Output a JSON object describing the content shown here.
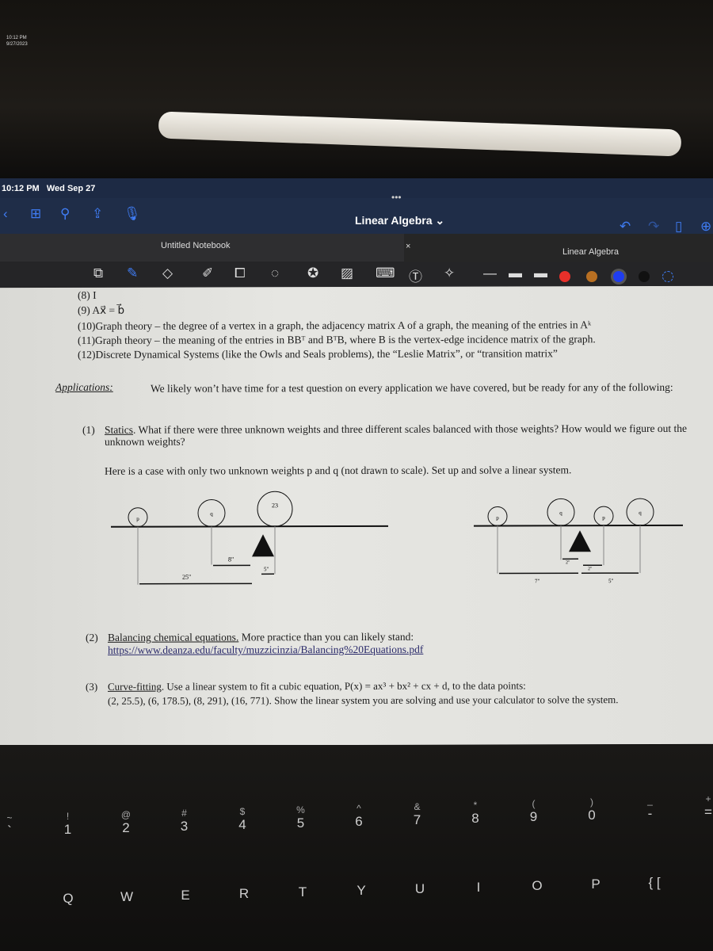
{
  "photo": {
    "mini_clock_time": "10:12 PM",
    "mini_clock_date": "9/27/2023"
  },
  "status": {
    "time": "10:12 PM",
    "date": "Wed Sep 27"
  },
  "topbar": {
    "title": "Linear Algebra",
    "more": "•••",
    "icons": [
      "back-icon",
      "grid-icon",
      "search-icon",
      "share-icon",
      "microphone-icon",
      "undo-icon",
      "redo-icon",
      "bookmark-icon",
      "add-page-icon"
    ]
  },
  "tabs": [
    {
      "label": "Untitled Notebook",
      "close": "×"
    },
    {
      "label": "Linear Algebra",
      "close": "×"
    }
  ],
  "tools": {
    "icons": [
      "zoom-window-icon",
      "pen-icon",
      "eraser-icon",
      "highlighter-icon",
      "shapes-icon",
      "lasso-icon",
      "sticker-icon",
      "image-icon",
      "keyboard-icon",
      "text-icon",
      "laser-pointer-icon"
    ],
    "colors": [
      "#e8302a",
      "#b86f22",
      "#1f3df0",
      "#111111"
    ],
    "selected_color": "#1f3df0"
  },
  "doc": {
    "list": [
      "(8) I",
      "(9) Ax⃗ = b⃗",
      "(10)Graph theory – the degree of a vertex in a graph, the adjacency matrix A of a graph, the meaning of the entries in Aᵏ",
      "(11)Graph theory – the meaning of the entries in BBᵀ and BᵀB, where B is the vertex-edge incidence matrix of the graph.",
      "(12)Discrete Dynamical Systems (like the Owls and Seals problems), the “Leslie Matrix”, or “transition matrix”"
    ],
    "applications_label": "Applications:",
    "applications_text": "We likely won’t have time for a test question on every application we have covered, but be ready for any of the following:",
    "item1_num": "(1)",
    "item1_title": "Statics",
    "item1_text": ". What if there were three unknown weights and three different scales balanced with those weights? How would we figure out the unknown weights?",
    "item1_sub": "Here is a case with only two unknown weights p and q (not drawn to scale). Set up and solve a linear system.",
    "fig1": {
      "w1": "p",
      "w2": "q",
      "w3": "23",
      "d1": "25\"",
      "d2": "8\"",
      "d3": "5\""
    },
    "fig2": {
      "w1": "p",
      "w2": "q",
      "w3": "p",
      "w4": "q",
      "d1": "7\"",
      "d2": "5\"",
      "d3": "2\"",
      "d4": "2\""
    },
    "item2_num": "(2)",
    "item2_title": "Balancing chemical equations.",
    "item2_text": " More practice than you can likely stand:",
    "item2_link": "https://www.deanza.edu/faculty/muzzicinzia/Balancing%20Equations.pdf",
    "item3_num": "(3)",
    "item3_title": "Curve-fitting",
    "item3_text": ". Use a linear system to fit a cubic equation, P(x) = ax³ + bx² + cx + d, to the data points:",
    "item3_points": "(2, 25.5), (6, 178.5), (8, 291), (16, 771).  Show the linear system you are solving and use your calculator to solve the system."
  },
  "keyboard": {
    "row1": [
      [
        "~",
        "`"
      ],
      [
        "!",
        "1"
      ],
      [
        "@",
        "2"
      ],
      [
        "#",
        "3"
      ],
      [
        "$",
        "4"
      ],
      [
        "%",
        "5"
      ],
      [
        "^",
        "6"
      ],
      [
        "&",
        "7"
      ],
      [
        "*",
        "8"
      ],
      [
        "(",
        "9"
      ],
      [
        ")",
        "0"
      ],
      [
        "_",
        "-"
      ],
      [
        "+",
        "="
      ]
    ],
    "row2": [
      "Q",
      "W",
      "E",
      "R",
      "T",
      "Y",
      "U",
      "I",
      "O",
      "P",
      "{ ["
    ]
  }
}
